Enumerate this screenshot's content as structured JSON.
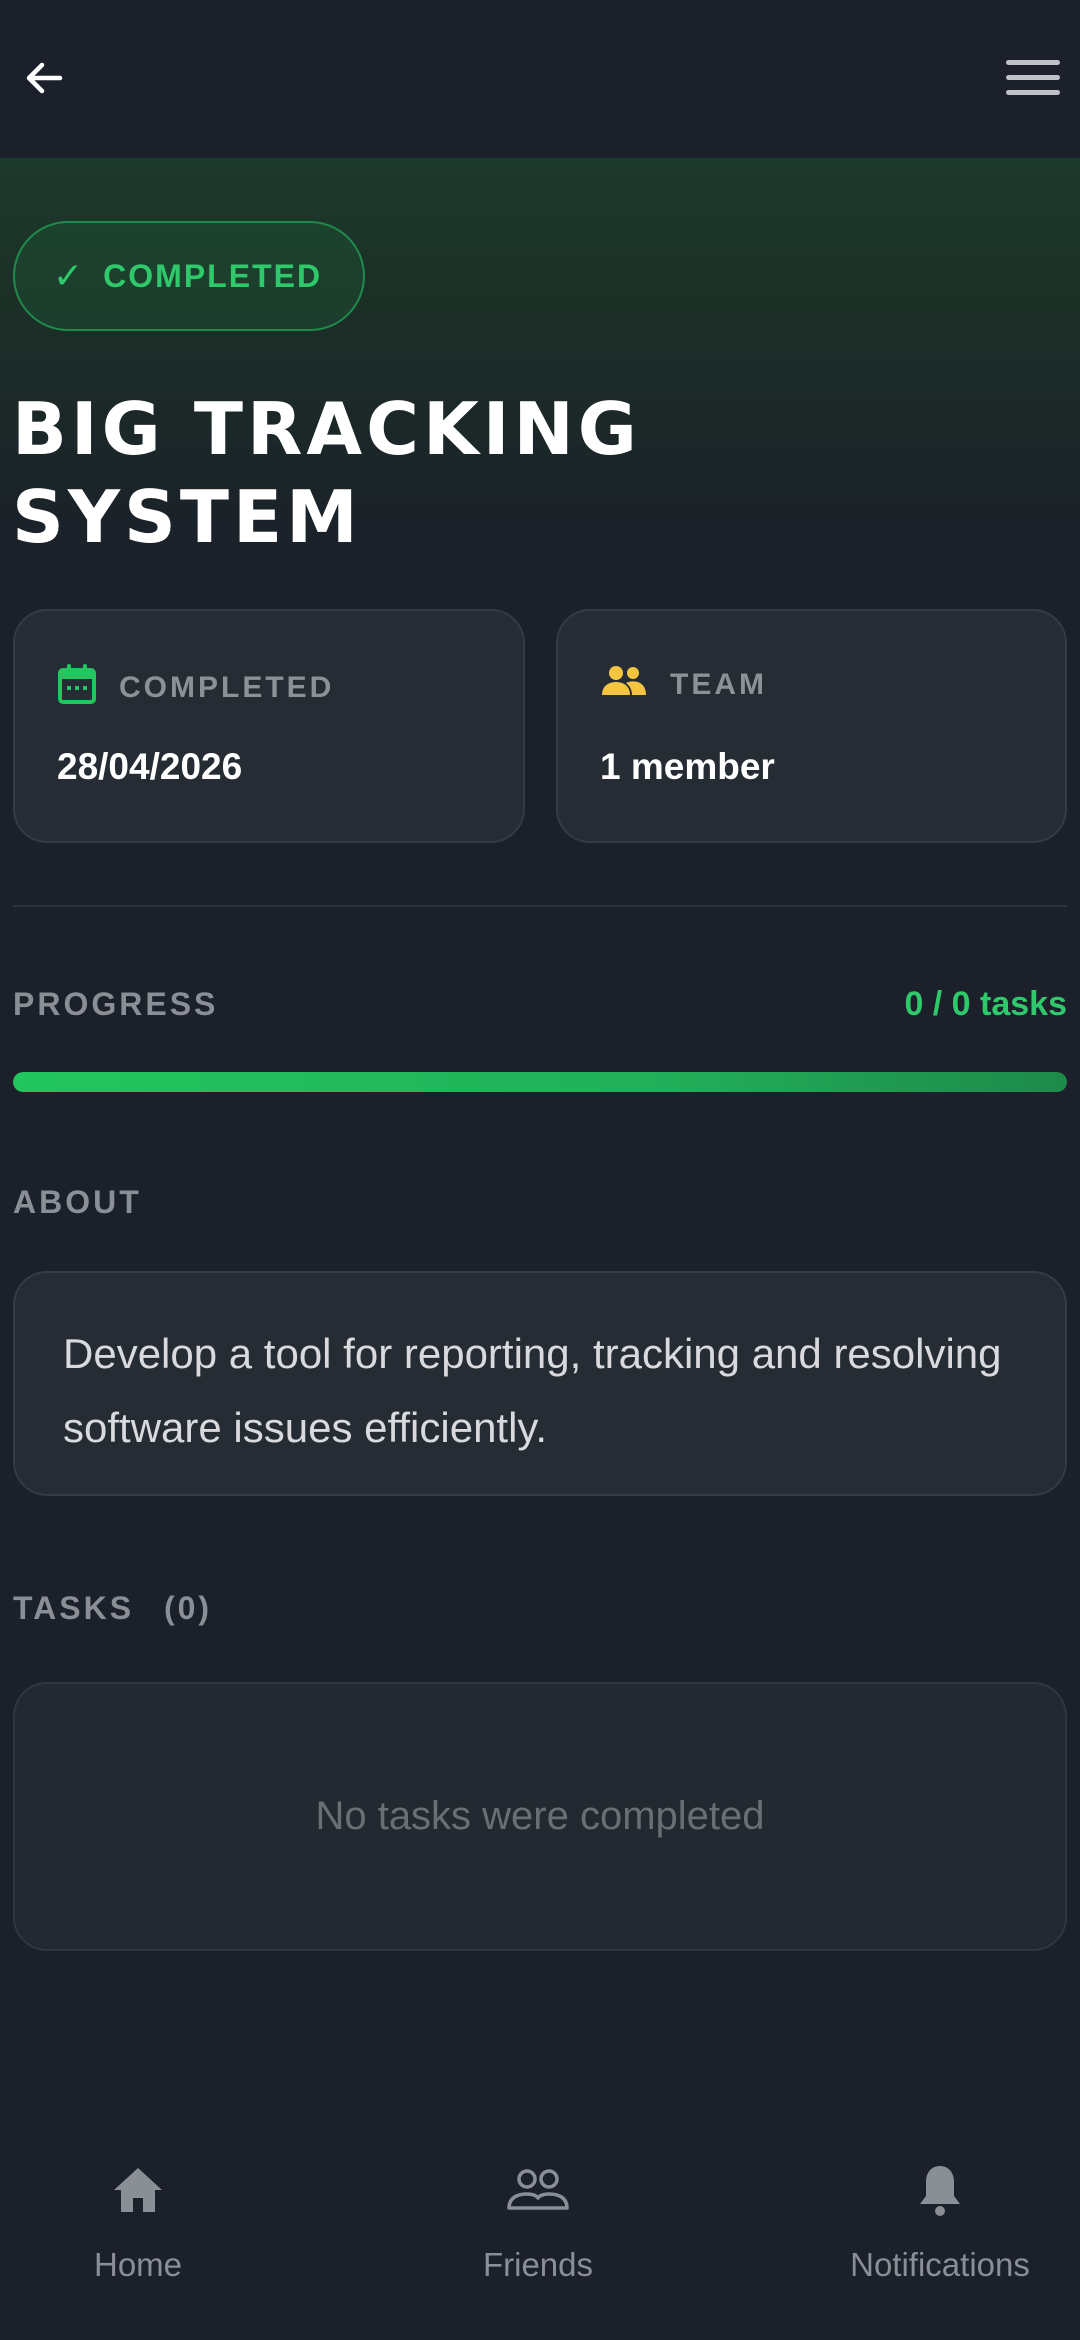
{
  "header": {
    "back_icon": "arrow-left-icon",
    "menu_icon": "hamburger-menu-icon"
  },
  "project": {
    "status": "COMPLETED",
    "title": "BIG TRACKING SYSTEM"
  },
  "info_cards": {
    "completed": {
      "label": "COMPLETED",
      "value": "28/04/2026",
      "icon": "calendar-icon",
      "icon_color": "#22c55e"
    },
    "team": {
      "label": "TEAM",
      "value": "1 member",
      "icon": "people-icon",
      "icon_color": "#f5c542"
    }
  },
  "progress": {
    "label": "PROGRESS",
    "count": "0 / 0 tasks",
    "fraction": 1.0
  },
  "about": {
    "label": "ABOUT",
    "text": "Develop a tool for reporting, tracking and resolving software issues efficiently."
  },
  "tasks": {
    "label": "TASKS",
    "count": "(0)",
    "empty_text": "No tasks were completed"
  },
  "bottom_nav": {
    "items": [
      {
        "label": "Home",
        "icon": "home-icon"
      },
      {
        "label": "Friends",
        "icon": "friends-icon"
      },
      {
        "label": "Notifications",
        "icon": "bell-icon"
      }
    ]
  },
  "colors": {
    "background": "#1b202b",
    "accent": "#22c55e",
    "card": "#262c33"
  }
}
